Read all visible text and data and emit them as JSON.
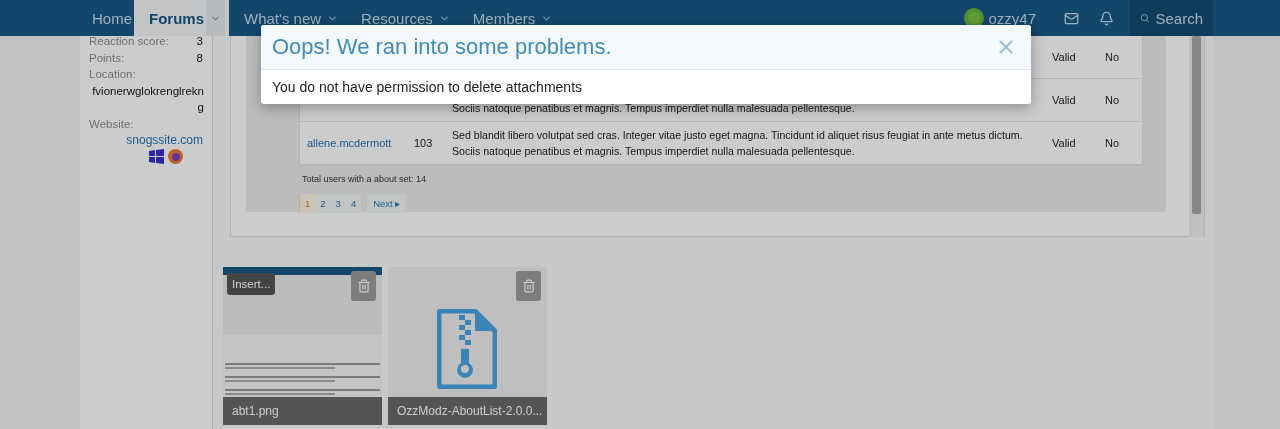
{
  "nav": {
    "tabs": [
      {
        "label": "Home",
        "selected": false,
        "dropdown": false
      },
      {
        "label": "Forums",
        "selected": true,
        "dropdown": true
      },
      {
        "label": "What's new",
        "selected": false,
        "dropdown": true
      },
      {
        "label": "Resources",
        "selected": false,
        "dropdown": true
      },
      {
        "label": "Members",
        "selected": false,
        "dropdown": true
      }
    ],
    "user": {
      "name": "ozzy47"
    },
    "search": {
      "label": "Search"
    }
  },
  "sidebar": {
    "stats": [
      {
        "label": "Reaction score:",
        "value": "3"
      },
      {
        "label": "Points:",
        "value": "8"
      }
    ],
    "location": {
      "label": "Location:",
      "value": "fvionerwglokrenglrekng"
    },
    "website": {
      "label": "Website:",
      "value": "snogssite.com"
    }
  },
  "table": {
    "rows": [
      {
        "user": "",
        "posts": "",
        "about": "",
        "status": "Valid",
        "flag": "No"
      },
      {
        "user": "",
        "posts": "",
        "about": "Sociis natoque penatibus et magnis. Tempus imperdiet nulla malesuada pellentesque.",
        "status": "Valid",
        "flag": "No"
      },
      {
        "user": "allene.mcdermott",
        "posts": "103",
        "about": "Sed blandit libero volutpat sed cras. Integer vitae justo eget magna. Tincidunt id aliquet risus feugiat in ante metus dictum. Sociis natoque penatibus et magnis. Tempus imperdiet nulla malesuada pellentesque.",
        "status": "Valid",
        "flag": "No"
      }
    ],
    "total": "Total users with a about set: 14",
    "pages": [
      {
        "label": "1",
        "selected": true
      },
      {
        "label": "2",
        "selected": false
      },
      {
        "label": "3",
        "selected": false
      },
      {
        "label": "4",
        "selected": false
      }
    ],
    "next": "Next ▸"
  },
  "attachments": [
    {
      "name": "abt1.png",
      "insert": "Insert..."
    },
    {
      "kind": "file",
      "name": "OzzModz-AboutList-2.0.0..."
    }
  ],
  "dialog": {
    "title": "Oops! We ran into some problems.",
    "message": "You do not have permission to delete attachments"
  }
}
